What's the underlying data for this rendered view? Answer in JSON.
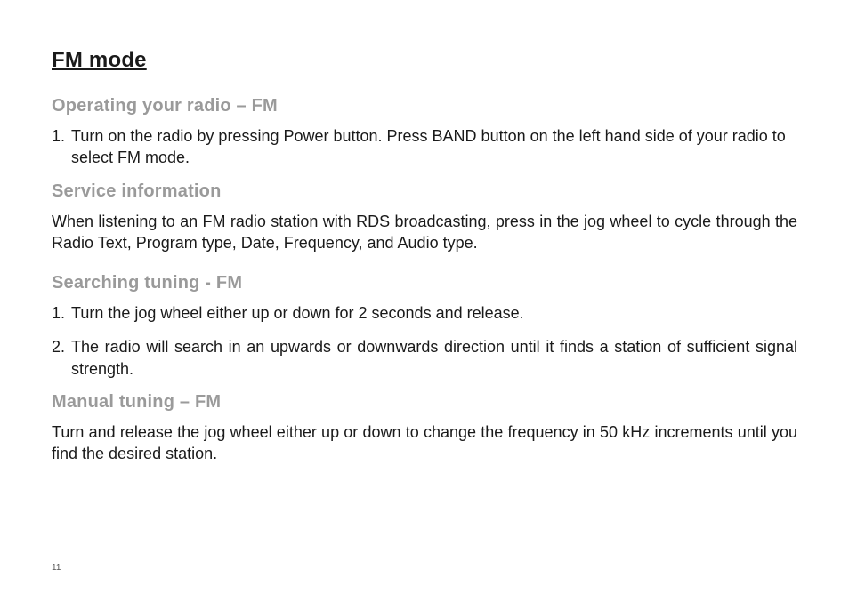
{
  "page": {
    "title": "FM mode",
    "number": "11"
  },
  "sections": {
    "operating": {
      "heading": "Operating your radio – FM",
      "item1_num": "1.",
      "item1_text": "Turn on the radio by pressing Power button. Press BAND button on the left hand side of your radio to select FM mode."
    },
    "service": {
      "heading": "Service information",
      "text": "When listening to an FM radio station with RDS broadcasting, press in the jog wheel to cycle through the Radio Text, Program type, Date, Frequency, and Audio type."
    },
    "searching": {
      "heading": "Searching tuning - FM",
      "item1_num": "1.",
      "item1_text": "Turn the jog wheel either up or down for 2 seconds and release.",
      "item2_num": "2.",
      "item2_text": "The radio will search in an upwards or downwards direction until it finds a station of sufficient signal strength."
    },
    "manual": {
      "heading": "Manual tuning – FM",
      "text": "Turn and release the jog wheel either up or down to change the frequency in 50 kHz increments until you find the desired station."
    }
  }
}
